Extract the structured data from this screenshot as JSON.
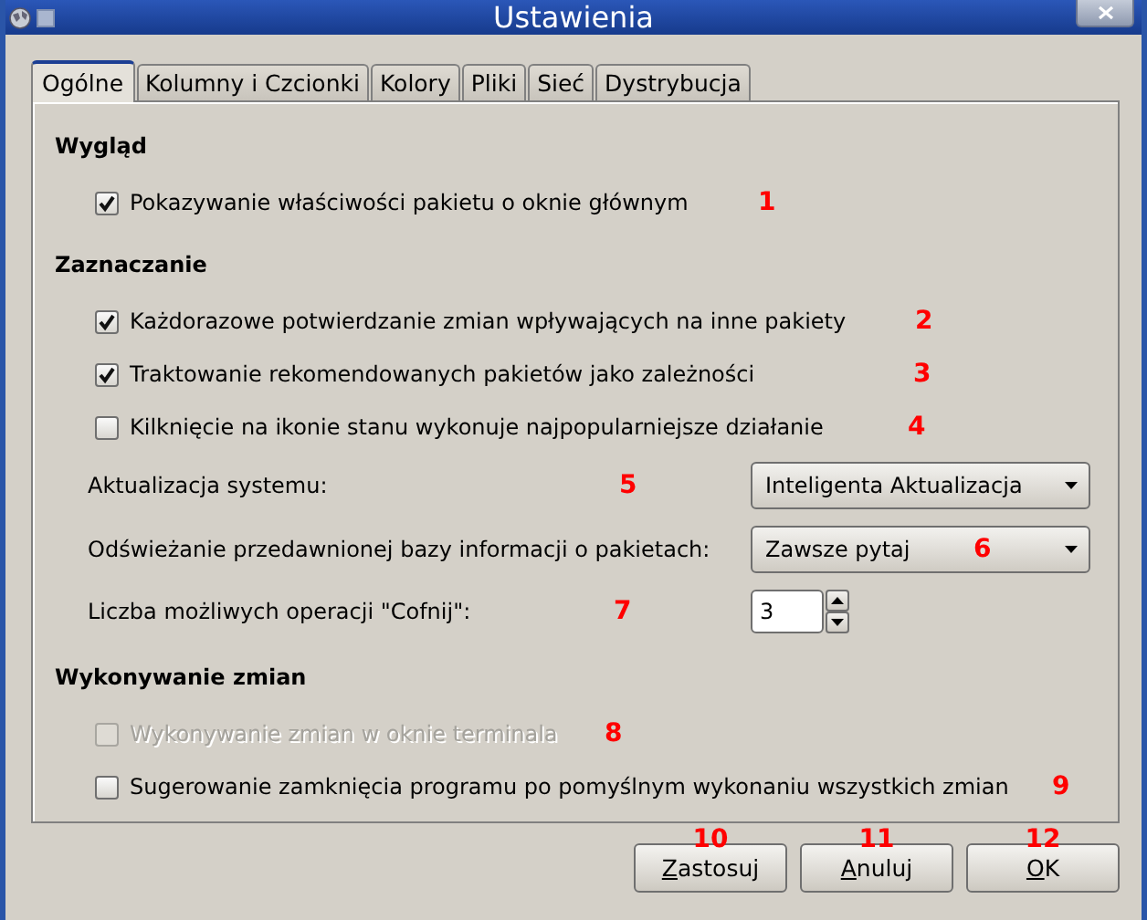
{
  "window": {
    "title": "Ustawienia"
  },
  "tabs": [
    {
      "label": "Ogólne",
      "selected": true
    },
    {
      "label": "Kolumny i Czcionki",
      "selected": false
    },
    {
      "label": "Kolory",
      "selected": false
    },
    {
      "label": "Pliki",
      "selected": false
    },
    {
      "label": "Sieć",
      "selected": false
    },
    {
      "label": "Dystrybucja",
      "selected": false
    }
  ],
  "sections": [
    {
      "heading": "Wygląd",
      "items": [
        {
          "kind": "checkbox",
          "label": "Pokazywanie właściwości pakietu o oknie głównym",
          "checked": true,
          "disabled": false,
          "annotation": "1"
        }
      ]
    },
    {
      "heading": "Zaznaczanie",
      "items": [
        {
          "kind": "checkbox",
          "label": "Każdorazowe potwierdzanie zmian wpływających na inne pakiety",
          "checked": true,
          "disabled": false,
          "annotation": "2"
        },
        {
          "kind": "checkbox",
          "label": "Traktowanie rekomendowanych pakietów jako zależności",
          "checked": true,
          "disabled": false,
          "annotation": "3"
        },
        {
          "kind": "checkbox",
          "label": "Kilknięcie na ikonie stanu wykonuje najpopularniejsze działanie",
          "checked": false,
          "disabled": false,
          "annotation": "4"
        },
        {
          "kind": "dropdown",
          "label": "Aktualizacja systemu:",
          "value": "Inteligenta Aktualizacja",
          "annotation": "5"
        },
        {
          "kind": "dropdown",
          "label": "Odświeżanie przedawnionej bazy informacji o pakietach:",
          "value": "Zawsze pytaj",
          "annotation": "6"
        },
        {
          "kind": "spin",
          "label": "Liczba możliwych operacji \"Cofnij\":",
          "value": "3",
          "annotation": "7"
        }
      ]
    },
    {
      "heading": "Wykonywanie zmian",
      "items": [
        {
          "kind": "checkbox",
          "label": "Wykonywanie zmian w oknie terminala",
          "checked": false,
          "disabled": true,
          "annotation": "8"
        },
        {
          "kind": "checkbox",
          "label": "Sugerowanie zamknięcia programu po pomyślnym wykonaniu wszystkich zmian",
          "checked": false,
          "disabled": false,
          "annotation": "9"
        }
      ]
    }
  ],
  "buttons": [
    {
      "label": "Zastosuj",
      "underline_first": true,
      "annotation": "10"
    },
    {
      "label": "Anuluj",
      "underline_first": true,
      "annotation": "11"
    },
    {
      "label": "OK",
      "underline_first": true,
      "annotation": "12"
    }
  ]
}
